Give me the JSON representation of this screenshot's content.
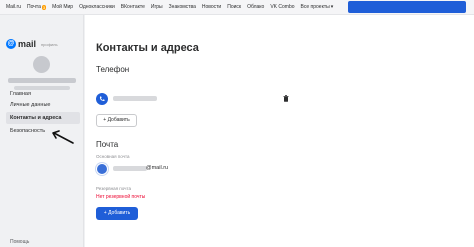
{
  "topnav": {
    "items": [
      "Mail.ru",
      "Почта",
      "Мой Мир",
      "Одноклассники",
      "ВКонтакте",
      "Игры",
      "Знакомства",
      "Новости",
      "Поиск",
      "Облако",
      "VK Combo",
      "Все проекты"
    ],
    "mail_badge": "3"
  },
  "sidebar": {
    "logo_text": "mail",
    "logo_sub": "профиль",
    "menu": [
      "Главная",
      "Личные данные",
      "Контакты и адреса",
      "Безопасность"
    ],
    "help": "Помощь"
  },
  "main": {
    "title": "Контакты и адреса",
    "phone_section": "Телефон",
    "add_phone": "+ Добавить",
    "mail_section": "Почта",
    "primary_label": "Основная почта",
    "mail_domain": "@mail.ru",
    "backup_label": "Резервная почта",
    "no_backup": "Нет резервной почты",
    "add_mail": "+ Добавить"
  },
  "colors": {
    "accent": "#1f5ed8",
    "error": "#ed0a34",
    "logo": "#0077ff"
  }
}
